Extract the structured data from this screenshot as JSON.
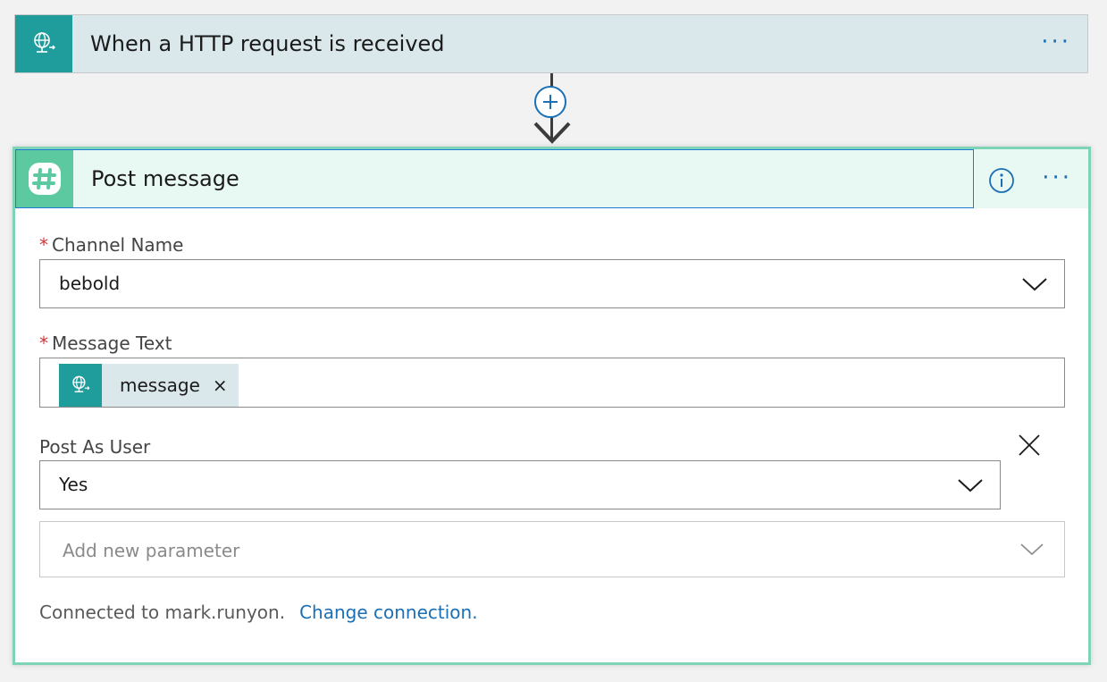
{
  "trigger": {
    "title": "When a HTTP request is received",
    "icon": "http-globe-icon",
    "menu": "···"
  },
  "connector": {
    "add_icon": "plus-icon"
  },
  "action": {
    "title": "Post message",
    "icon": "slack-icon",
    "menu": "···",
    "info_icon": "info-icon",
    "fields": {
      "channel_name": {
        "required_mark": "*",
        "label": "Channel Name",
        "value": "bebold"
      },
      "message_text": {
        "required_mark": "*",
        "label": "Message Text",
        "token": "message",
        "token_remove": "×"
      },
      "post_as_user": {
        "label": "Post As User",
        "value": "Yes"
      },
      "add_parameter": {
        "placeholder": "Add new parameter"
      }
    },
    "footer": {
      "connected_text": "Connected to mark.runyon.",
      "change_link": "Change connection."
    }
  },
  "colors": {
    "trigger_icon_bg": "#1f9d9c",
    "slack_icon_bg": "#5cc9a0",
    "action_border": "#80d4b6",
    "link": "#1a6fb5",
    "required": "#d13438"
  }
}
